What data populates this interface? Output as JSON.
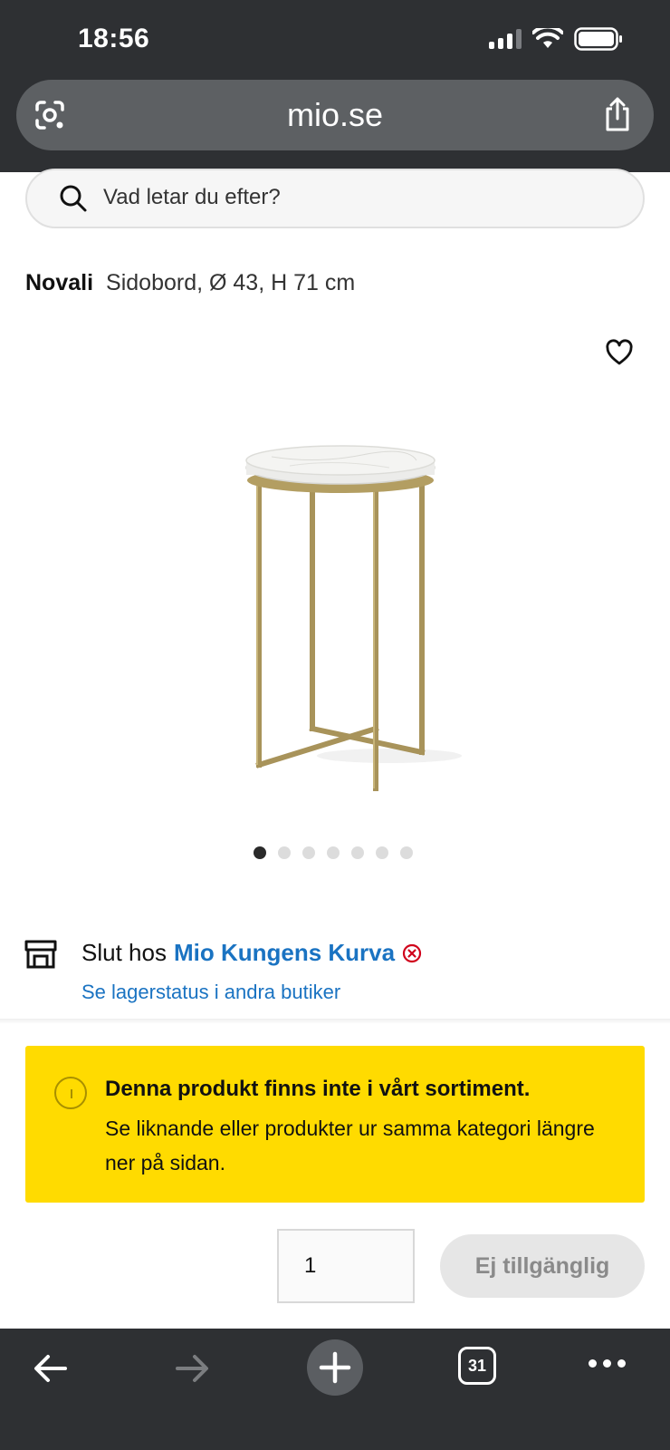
{
  "status_bar": {
    "time": "18:56"
  },
  "browser": {
    "url": "mio.se",
    "tab_count": "31"
  },
  "search": {
    "placeholder": "Vad letar du efter?"
  },
  "product": {
    "brand": "Novali",
    "subtitle": "Sidobord, Ø 43, H 71 cm",
    "image_count": 7,
    "active_image": 1
  },
  "store": {
    "status_prefix": "Slut hos",
    "store_name": "Mio Kungens Kurva",
    "stock_link": "Se lagerstatus i andra butiker"
  },
  "notice": {
    "title": "Denna produkt finns inte i vårt sortiment.",
    "body": "Se liknande eller produkter ur samma kategori längre ner på sidan."
  },
  "purchase": {
    "quantity": "1",
    "button_label": "Ej tillgänglig"
  },
  "colors": {
    "chrome": "#2e3033",
    "link": "#1a73c2",
    "notice_bg": "#ffdb00",
    "error": "#d0021b"
  }
}
